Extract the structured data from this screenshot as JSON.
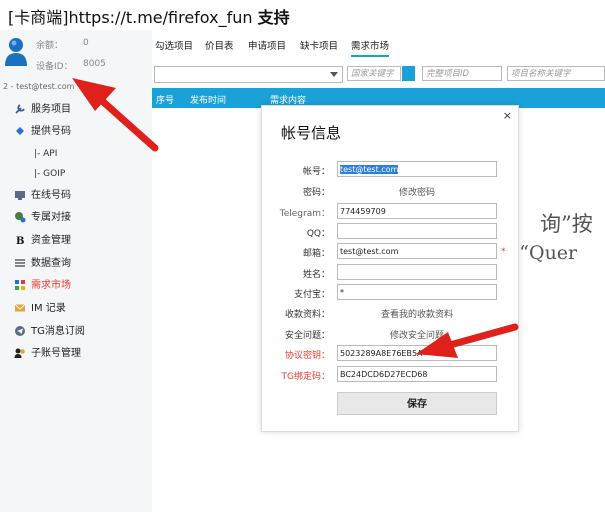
{
  "title": {
    "part1": "[卡商端]https://t.me/firefox_fun ",
    "part2": "支持"
  },
  "sidebar": {
    "balance_label": "余额：",
    "balance_value": "0",
    "device_label": "设备ID：",
    "device_value": "8005",
    "account": "2 - test@test.com",
    "items": [
      {
        "label": "服务项目",
        "icon": "wrench-icon",
        "active": false
      },
      {
        "label": "提供号码",
        "icon": "diamond-icon",
        "active": false
      },
      {
        "label": "在线号码",
        "icon": "monitor-icon",
        "active": false
      },
      {
        "label": "专属对接",
        "icon": "user-link-icon",
        "active": false
      },
      {
        "label": "资金管理",
        "icon": "bold-b-icon",
        "active": false
      },
      {
        "label": "数据查询",
        "icon": "list-icon",
        "active": false
      },
      {
        "label": "需求市场",
        "icon": "grid-icon",
        "active": true
      },
      {
        "label": "IM 记录",
        "icon": "mail-icon",
        "active": false
      },
      {
        "label": "TG消息订阅",
        "icon": "telegram-icon",
        "active": false
      },
      {
        "label": "子账号管理",
        "icon": "users-icon",
        "active": false
      }
    ],
    "sub_items": [
      "|-  API",
      "|-  GOIP"
    ]
  },
  "tabs": [
    {
      "label": "勾选项目",
      "active": false
    },
    {
      "label": "价目表",
      "active": false
    },
    {
      "label": "申请项目",
      "active": false
    },
    {
      "label": "缺卡项目",
      "active": false
    },
    {
      "label": "需求市场",
      "active": true
    }
  ],
  "filters": {
    "country_placeholder": "国家关键字",
    "completed_placeholder": "完整项目ID",
    "project_name_placeholder": "项目名称关键字"
  },
  "table": {
    "columns": [
      "序号",
      "发布时间",
      "需求内容"
    ]
  },
  "background_text": {
    "line1": "询”按",
    "line2": "e “Quer"
  },
  "dialog": {
    "title": "帐号信息",
    "close": "×",
    "fields": {
      "account_label": "帐号：",
      "account_value": "test@test.com",
      "password_label": "密码：",
      "password_link": "修改密码",
      "telegram_label": "Telegram：",
      "telegram_value": "774459709",
      "qq_label": "QQ：",
      "qq_value": "",
      "email_label": "邮箱：",
      "email_value": "test@test.com",
      "email_required": "*",
      "name_label": "姓名：",
      "name_value": "",
      "alipay_label": "支付宝：",
      "alipay_value": "*",
      "payment_label": "收款资料：",
      "payment_link": "查看我的收款资料",
      "security_label": "安全问题：",
      "security_link": "修改安全问题",
      "protocol_key_label": "协议密钥：",
      "protocol_key_value": "5023289A8E76EB5A",
      "tg_code_label": "TG绑定码：",
      "tg_code_value": "BC24DCD6D27ECD68"
    },
    "save_label": "保存"
  },
  "colors": {
    "accent": "#1aa1d8",
    "red": "#e63b2e",
    "arrow": "#e0201a"
  }
}
